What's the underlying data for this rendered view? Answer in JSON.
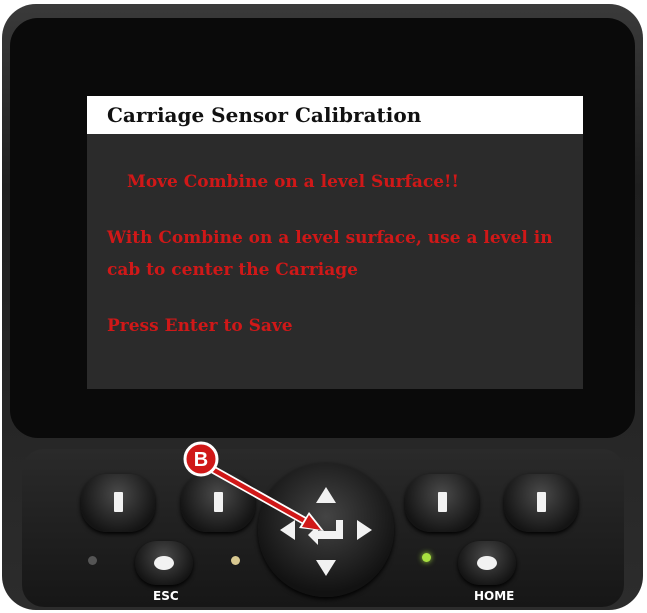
{
  "screen": {
    "title": "Carriage Sensor Calibration",
    "message_1": "Move Combine on a level Surface!!",
    "message_2": "With Combine on a level surface, use a level in cab to center the Carriage",
    "message_3": "Press Enter to Save"
  },
  "keypad": {
    "esc_label": "ESC",
    "home_label": "HOME"
  },
  "annotation": {
    "callout_label": "B",
    "callout_color": "#d01818"
  },
  "icons": [
    "up-arrow-icon",
    "down-arrow-icon",
    "left-arrow-icon",
    "right-arrow-icon",
    "enter-icon"
  ]
}
